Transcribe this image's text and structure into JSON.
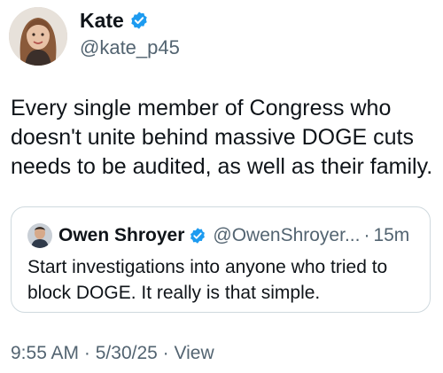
{
  "author": {
    "name": "Kate",
    "handle": "@kate_p45",
    "verified_icon": "verified-badge-icon",
    "badge_color": "#1d9bf0"
  },
  "tweet": {
    "text": "Every single member of Congress who doesn't unite behind massive DOGE cuts needs to be audited, as well as their family."
  },
  "quoted_tweet": {
    "name": "Owen Shroyer",
    "handle": "@OwenShroyer...",
    "separator": "·",
    "time": "15m",
    "text": "Start investigations into anyone who tried to block DOGE. It really is that simple."
  },
  "meta": {
    "time": "9:55 AM",
    "sep1": "·",
    "date": "5/30/25",
    "sep2": "·",
    "views": "View"
  }
}
